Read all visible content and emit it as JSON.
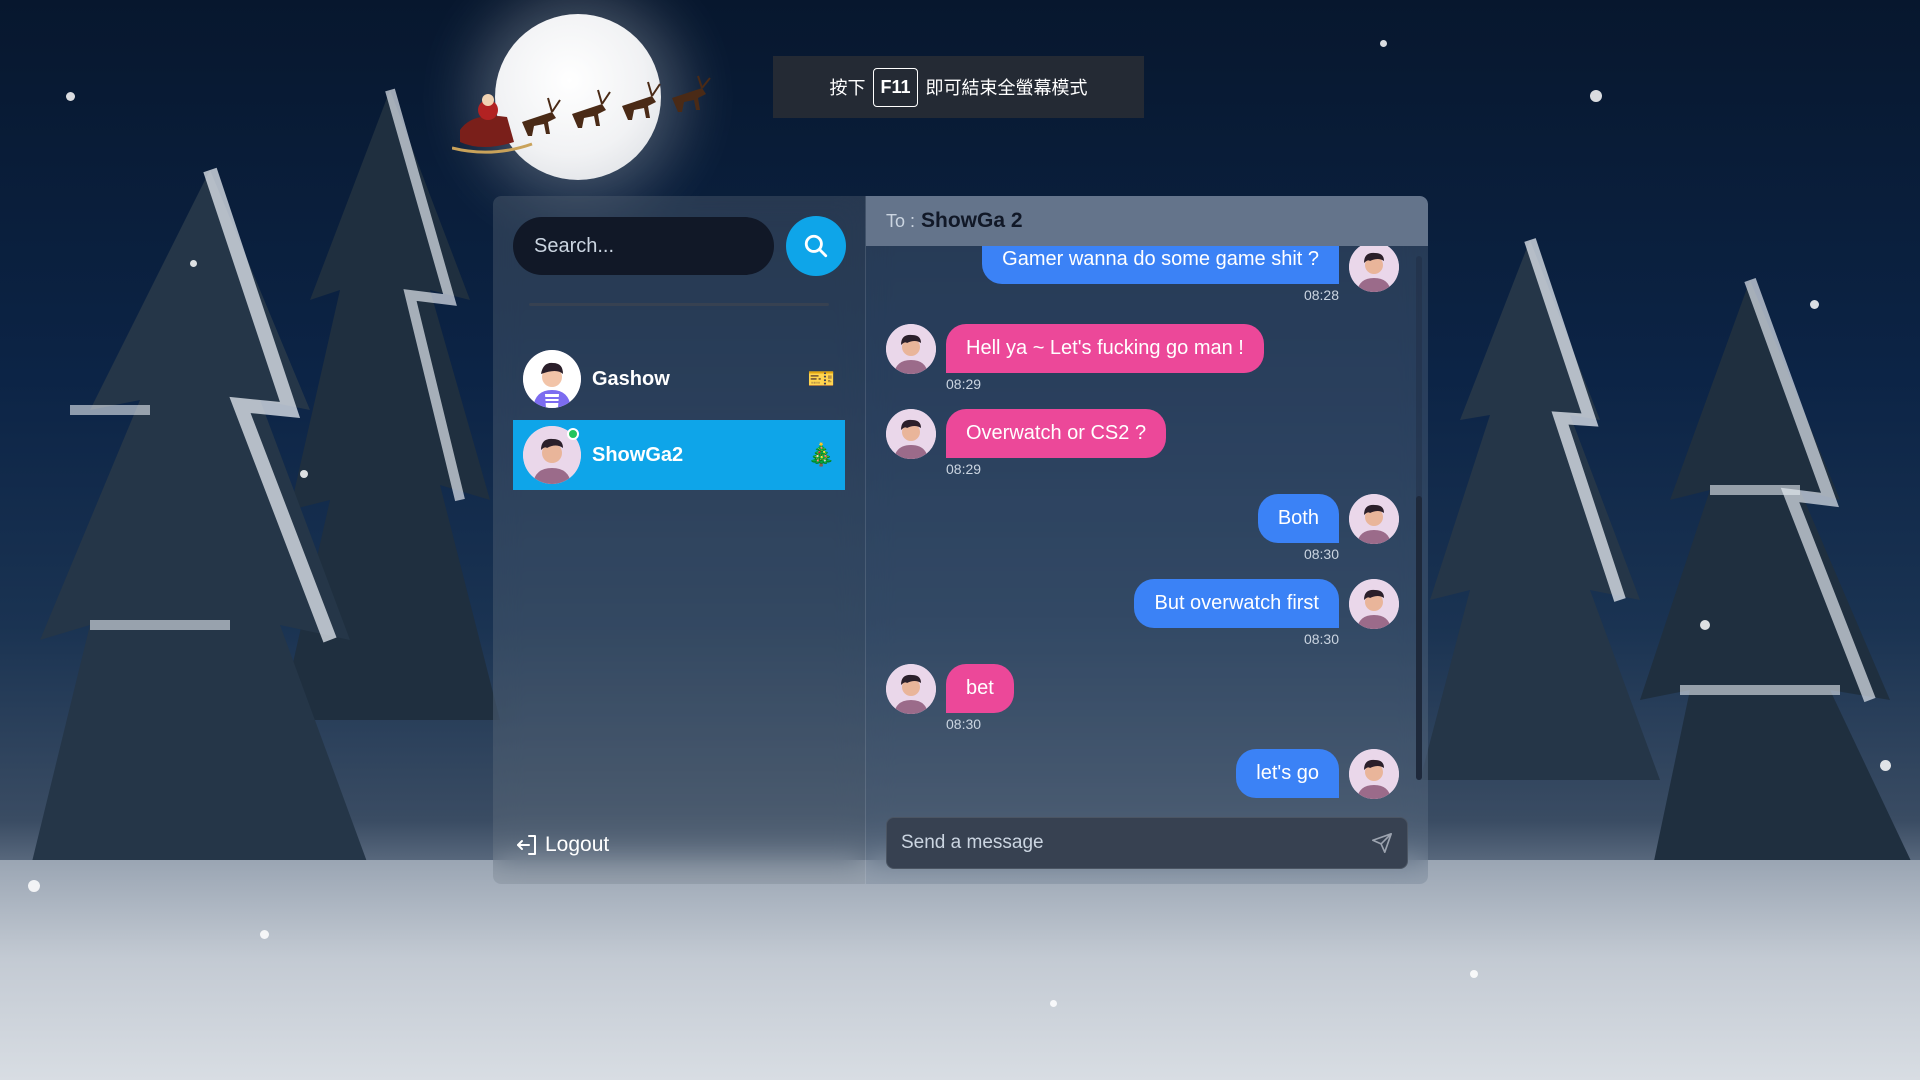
{
  "fullscreen_toast": {
    "before_key": "按下",
    "key": "F11",
    "after_key": "即可結束全螢幕模式"
  },
  "sidebar": {
    "search": {
      "placeholder": "Search..."
    },
    "contacts": [
      {
        "name": "Gashow",
        "emoji": "🎫",
        "active": false,
        "online": false
      },
      {
        "name": "ShowGa2",
        "emoji": "🎄",
        "active": true,
        "online": true
      }
    ],
    "logout_label": "Logout"
  },
  "chat": {
    "to_label": "To :",
    "to_name": "ShowGa 2",
    "messages": [
      {
        "direction": "out",
        "text": "Gamer wanna do some game shit ?",
        "time": "08:28"
      },
      {
        "direction": "in",
        "text": "Hell ya ~ Let's fucking go man !",
        "time": "08:29"
      },
      {
        "direction": "in",
        "text": "Overwatch or CS2 ?",
        "time": "08:29"
      },
      {
        "direction": "out",
        "text": "Both",
        "time": "08:30"
      },
      {
        "direction": "out",
        "text": "But overwatch first",
        "time": "08:30"
      },
      {
        "direction": "in",
        "text": "bet",
        "time": "08:30"
      },
      {
        "direction": "out",
        "text": "let's go",
        "time": ""
      }
    ],
    "composer": {
      "placeholder": "Send a message"
    }
  },
  "colors": {
    "accent": "#0ea5e9",
    "outgoing_bubble": "#3b82f6",
    "incoming_bubble": "#ec4899",
    "online": "#22c55e"
  }
}
